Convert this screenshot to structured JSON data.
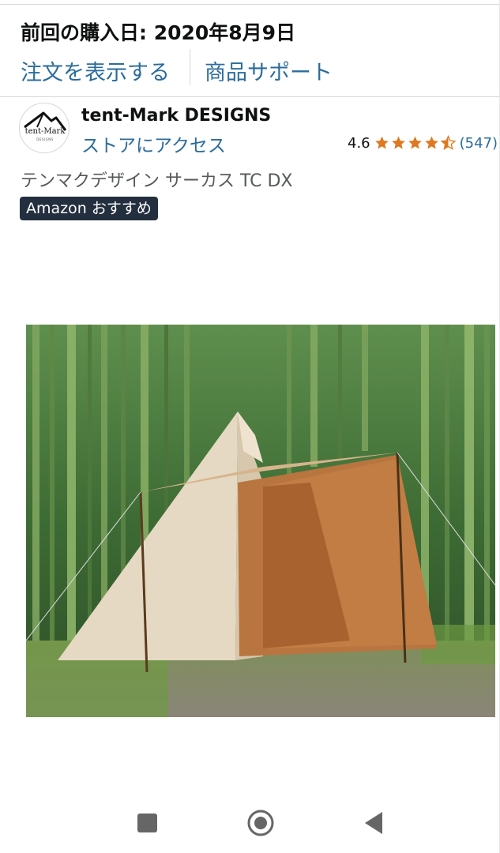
{
  "order": {
    "date_label": "前回の購入日: 2020年8月9日"
  },
  "actions": {
    "view_order": "注文を表示する",
    "product_support": "商品サポート"
  },
  "brand": {
    "logo_text": "tent-Mark",
    "logo_subtext": "DESIGNS",
    "name": "tent-Mark DESIGNS",
    "store_link": "ストアにアクセス"
  },
  "rating": {
    "value": "4.6",
    "stars": 4.6,
    "count": "(547)",
    "star_color": "#de7921"
  },
  "product": {
    "title": "テンマクデザイン サーカス TC DX",
    "badge": "Amazon おすすめ",
    "image_icon": "product-photo-tent"
  },
  "nav": {
    "recents_icon": "square-recents-icon",
    "home_icon": "circle-home-icon",
    "back_icon": "triangle-back-icon"
  },
  "colors": {
    "link": "#2b6c9c",
    "badge_bg": "#232f3e",
    "text": "#0f1111",
    "muted": "#565959"
  }
}
